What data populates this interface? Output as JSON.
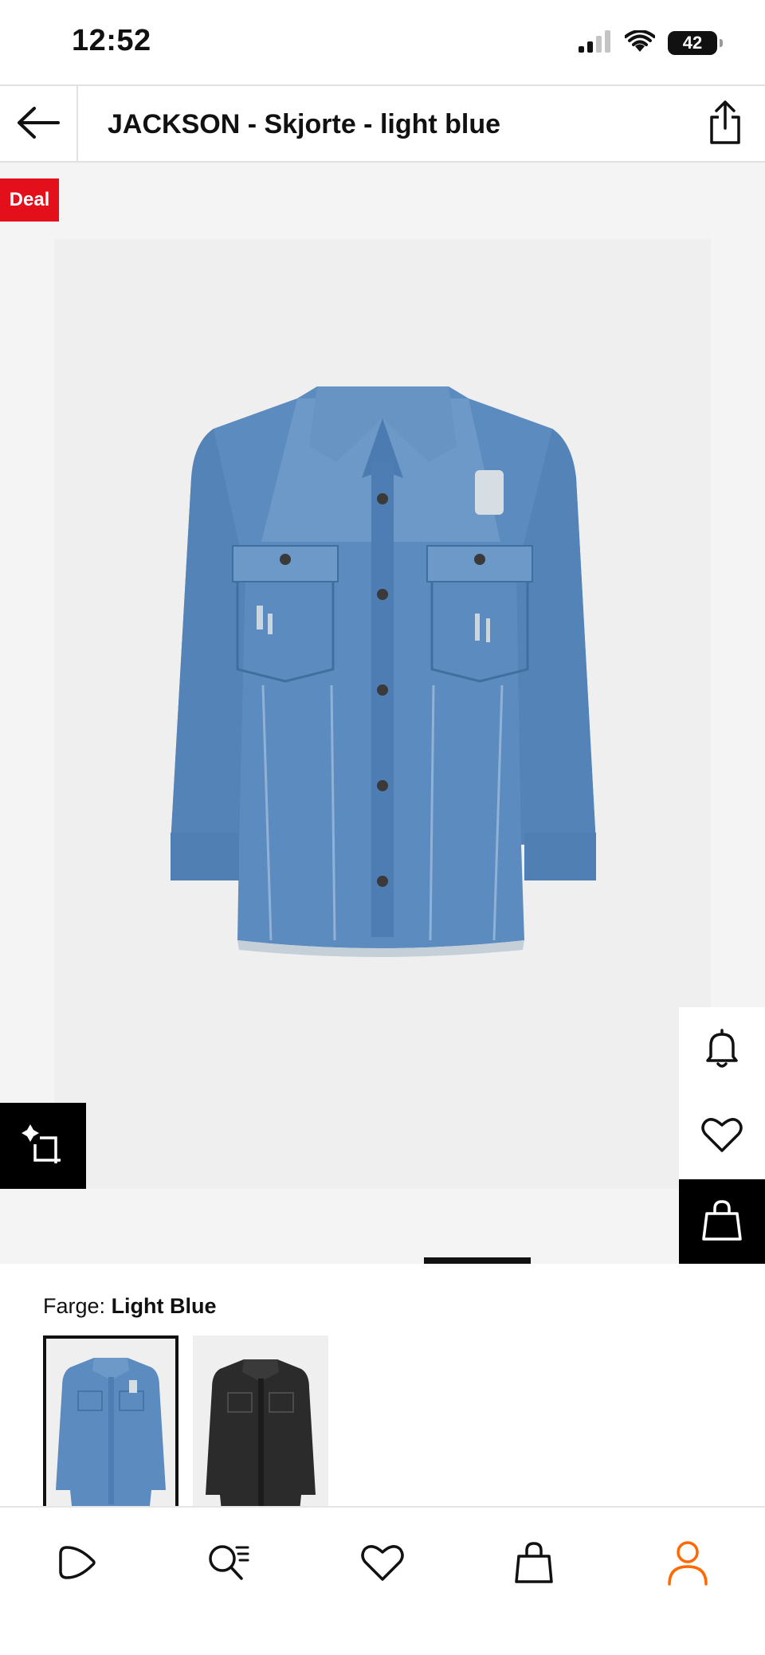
{
  "status_bar": {
    "time": "12:52",
    "battery_level": "42",
    "icons": [
      "signal-icon",
      "wifi-icon",
      "battery-icon"
    ]
  },
  "header": {
    "title": "JACKSON - Skjorte - light blue",
    "back_icon": "arrow-left-icon",
    "share_icon": "share-icon"
  },
  "gallery": {
    "badge": "Deal",
    "image_subject": "light blue denim shirt",
    "side_actions": [
      "bell-icon",
      "heart-icon",
      "shopping-bag-icon"
    ],
    "ai_button_icon": "sparkle-crop-icon"
  },
  "color": {
    "label_prefix": "Farge:",
    "label_value": "Light Blue",
    "swatches": [
      {
        "name": "light blue",
        "selected": true
      },
      {
        "name": "black",
        "selected": false
      }
    ]
  },
  "tab_bar": {
    "tabs": [
      "play-icon",
      "search-list-icon",
      "heart-icon",
      "shopping-bag-icon",
      "profile-icon"
    ],
    "active_tab": "profile-icon"
  },
  "colors": {
    "deal_red": "#e3101c",
    "accent_orange": "#ff6900",
    "text": "#111111",
    "gallery_bg": "#f4f4f4",
    "denim": "#5c8bbf"
  }
}
